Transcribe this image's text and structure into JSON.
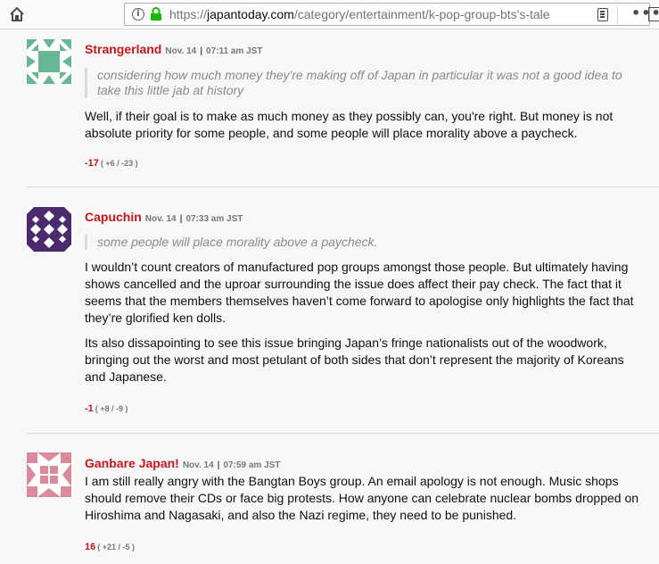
{
  "browser": {
    "url_prefix": "https://",
    "url_domain": "japantoday.com",
    "url_path": "/category/entertainment/k-pop-group-bts's-tale",
    "menu_glyph": "•••"
  },
  "comments": [
    {
      "author": "Strangerland",
      "date": "Nov. 14",
      "time": "07:11 am JST",
      "quote": "considering how much money they're making off of Japan in particular it was not a good idea to take this little jab at history",
      "paragraphs": [
        "Well, if their goal is to make as much money as they possibly can, you're right. But money is not absolute priority for some people, and some people will place morality above a paycheck."
      ],
      "score": "-17",
      "breakdown": "( +6 / -23 )",
      "avatar_color": "#66b892"
    },
    {
      "author": "Capuchin",
      "date": "Nov. 14",
      "time": "07:33 am JST",
      "quote": "some people will place morality above a paycheck.",
      "paragraphs": [
        "I wouldn’t count creators of manufactured pop groups amongst those people. But ultimately having shows cancelled and the uproar surrounding the issue does affect their pay check. The fact that it seems that the members themselves haven’t come forward to apologise only highlights the fact that they’re glorified ken dolls.",
        "Its also dissapointing to see this issue bringing Japan’s fringe nationalists out of the woodwork, bringing out the worst and most petulant of both sides that don’t represent the majority of Koreans and Japanese."
      ],
      "score": "-1",
      "breakdown": "( +8 / -9 )",
      "avatar_color": "#4b2b6e"
    },
    {
      "author": "Ganbare Japan!",
      "date": "Nov. 14",
      "time": "07:59 am JST",
      "quote": "",
      "paragraphs": [
        "I am still really angry with the Bangtan Boys group. An email apology is not enough. Music shops should remove their CDs or face big protests. How anyone can celebrate nuclear bombs dropped on Hiroshima and Nagasaki, and also the Nazi regime, they need to be punished."
      ],
      "score": "16",
      "breakdown": "( +21 / -5 )",
      "avatar_color": "#d98a9b"
    }
  ]
}
